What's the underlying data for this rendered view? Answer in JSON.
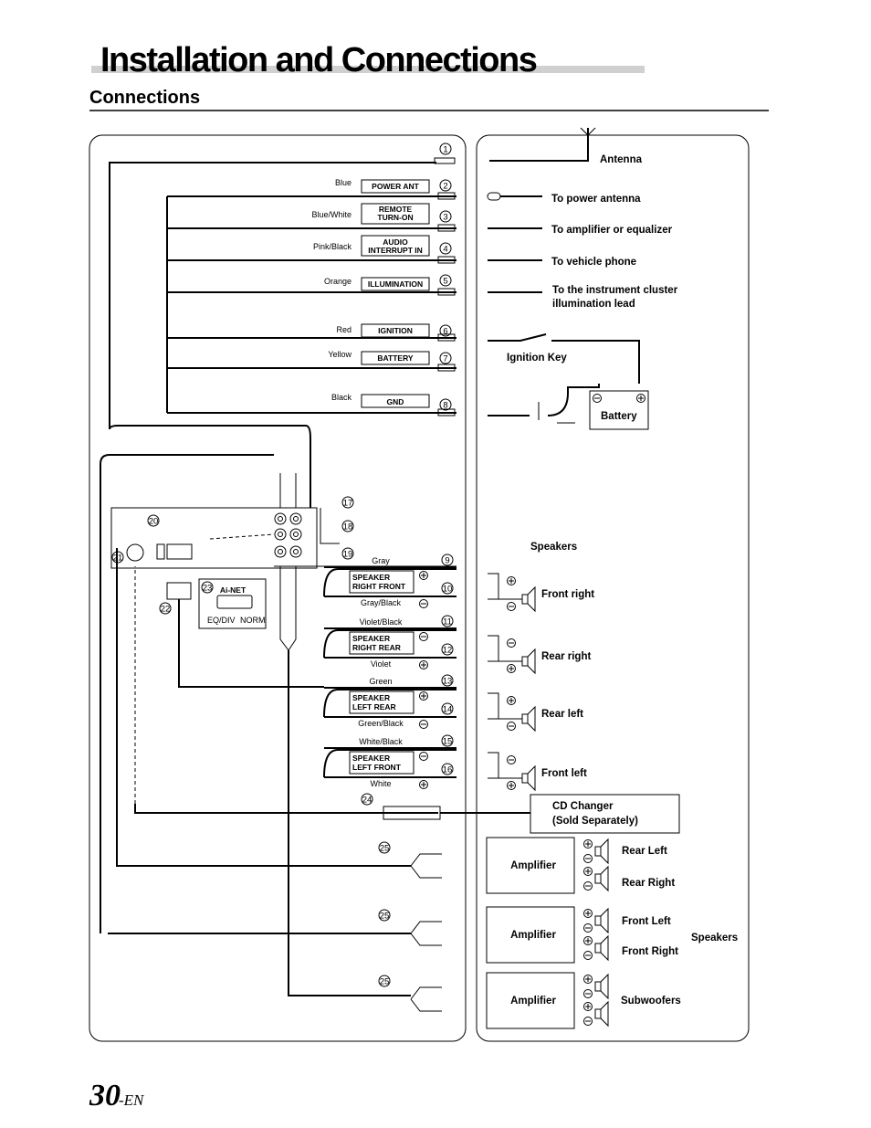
{
  "header": {
    "title": "Installation and Connections",
    "section": "Connections"
  },
  "footer": {
    "page_number": "30",
    "suffix": "-EN"
  },
  "harness": {
    "wires": [
      {
        "num": "1",
        "color": "",
        "label": []
      },
      {
        "num": "2",
        "color": "Blue",
        "label": [
          "POWER ANT"
        ]
      },
      {
        "num": "3",
        "color": "Blue/White",
        "label": [
          "REMOTE",
          "TURN-ON"
        ]
      },
      {
        "num": "4",
        "color": "Pink/Black",
        "label": [
          "AUDIO",
          "INTERRUPT IN"
        ]
      },
      {
        "num": "5",
        "color": "Orange",
        "label": [
          "ILLUMINATION"
        ]
      },
      {
        "num": "6",
        "color": "Red",
        "label": [
          "IGNITION"
        ]
      },
      {
        "num": "7",
        "color": "Yellow",
        "label": [
          "BATTERY"
        ]
      },
      {
        "num": "8",
        "color": "Black",
        "label": [
          "GND"
        ]
      }
    ],
    "destinations": {
      "antenna": "Antenna",
      "power_antenna": "To power antenna",
      "amplifier": "To amplifier or equalizer",
      "phone": "To vehicle phone",
      "illumination1": "To the instrument cluster",
      "illumination2": "illumination lead",
      "ignition_key": "Ignition Key",
      "battery": "Battery"
    }
  },
  "speakers": {
    "title": "Speakers",
    "groups": [
      {
        "label": [
          "SPEAKER",
          "RIGHT FRONT"
        ],
        "top_color": "Gray",
        "bottom_color": "Gray/Black",
        "top_num": "9",
        "bottom_num": "10",
        "dest": "Front right"
      },
      {
        "label": [
          "SPEAKER",
          "RIGHT REAR"
        ],
        "top_color": "Violet/Black",
        "bottom_color": "Violet",
        "top_num": "11",
        "bottom_num": "12",
        "dest": "Rear right"
      },
      {
        "label": [
          "SPEAKER",
          "LEFT REAR"
        ],
        "top_color": "Green",
        "bottom_color": "Green/Black",
        "top_num": "13",
        "bottom_num": "14",
        "dest": "Rear left"
      },
      {
        "label": [
          "SPEAKER",
          "LEFT FRONT"
        ],
        "top_color": "White/Black",
        "bottom_color": "White",
        "top_num": "15",
        "bottom_num": "16",
        "dest": "Front left"
      }
    ]
  },
  "unit": {
    "nums": [
      "17",
      "18",
      "19",
      "20",
      "21",
      "22",
      "23",
      "24",
      "25"
    ],
    "ainet": "Ai-NET",
    "switch_left": "EQ/DIV",
    "switch_right": "NORM"
  },
  "cd_changer": {
    "line1": "CD Changer",
    "line2": "(Sold Separately)"
  },
  "amplifiers": [
    {
      "label": "Amplifier",
      "outputs": [
        "Rear Left",
        "Rear Right"
      ]
    },
    {
      "label": "Amplifier",
      "outputs": [
        "Front Left",
        "Front Right"
      ]
    },
    {
      "label": "Amplifier",
      "outputs": [
        "Subwoofers"
      ]
    }
  ],
  "amp_speakers_label": "Speakers"
}
